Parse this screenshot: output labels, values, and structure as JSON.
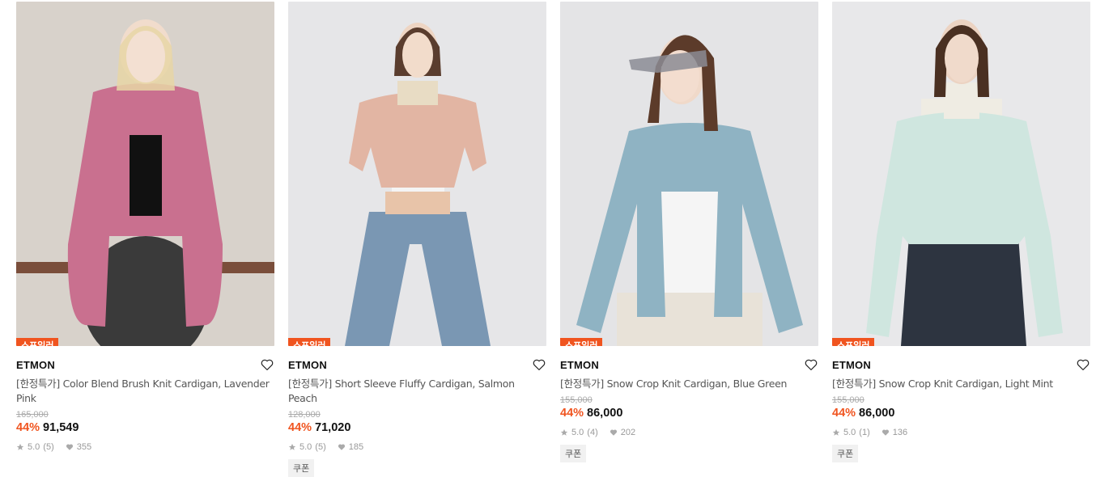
{
  "spoiler_label": "스포일러",
  "coupon_label": "쿠폰",
  "colors": {
    "accent": "#f0541f"
  },
  "products": [
    {
      "brand": "ETMON",
      "name": "[한정특가] Color Blend Brush Knit Cardigan, Lavender Pink",
      "original_price": "165,000",
      "discount": "44%",
      "price": "91,549",
      "rating": "5.0",
      "reviews": "(5)",
      "likes": "355",
      "photo_colors": {
        "bg": "#d8d2cb",
        "garment": "#c9708f",
        "bottom": "#3a3a3a"
      }
    },
    {
      "brand": "ETMON",
      "name": "[한정특가] Short Sleeve Fluffy Cardigan, Salmon Peach",
      "original_price": "128,000",
      "discount": "44%",
      "price": "71,020",
      "rating": "5.0",
      "reviews": "(5)",
      "likes": "185",
      "photo_colors": {
        "bg": "#e6e6e8",
        "garment": "#e2b5a3",
        "bottom": "#7a97b3"
      }
    },
    {
      "brand": "ETMON",
      "name": "[한정특가] Snow Crop Knit Cardigan, Blue Green",
      "original_price": "155,000",
      "discount": "44%",
      "price": "86,000",
      "rating": "5.0",
      "reviews": "(4)",
      "likes": "202",
      "photo_colors": {
        "bg": "#e4e4e6",
        "garment": "#8fb3c3",
        "bottom": "#e8e2d8"
      }
    },
    {
      "brand": "ETMON",
      "name": "[한정특가] Snow Crop Knit Cardigan, Light Mint",
      "original_price": "155,000",
      "discount": "44%",
      "price": "86,000",
      "rating": "5.0",
      "reviews": "(1)",
      "likes": "136",
      "photo_colors": {
        "bg": "#e8e8ea",
        "garment": "#cfe6df",
        "bottom": "#2d3440"
      }
    }
  ]
}
